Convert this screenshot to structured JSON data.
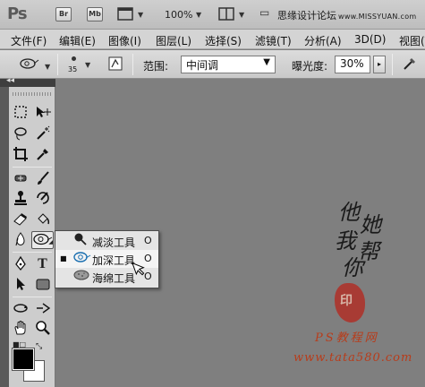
{
  "app": {
    "logo": "Ps",
    "bridge_label": "Br",
    "minibridge_label": "Mb",
    "zoom": "100%",
    "watermark_text": "思缘设计论坛",
    "watermark_url": "www.MISSYUAN.com"
  },
  "menu": [
    "文件(F)",
    "编辑(E)",
    "图像(I)",
    "图层(L)",
    "选择(S)",
    "滤镜(T)",
    "分析(A)",
    "3D(D)",
    "视图(V)"
  ],
  "options": {
    "brush_size": "35",
    "range_label": "范围:",
    "range_value": "中间调",
    "exposure_label": "曝光度:",
    "exposure_value": "30%"
  },
  "panel": {
    "collapse_glyph": "◂◂"
  },
  "flyout": [
    {
      "label": "减淡工具",
      "key": "O",
      "icon": "dodge-icon",
      "selected": false
    },
    {
      "label": "加深工具",
      "key": "O",
      "icon": "burn-icon",
      "selected": true
    },
    {
      "label": "海绵工具",
      "key": "O",
      "icon": "sponge-icon",
      "selected": false
    }
  ],
  "canvas_art": {
    "calligraphy": [
      "他",
      "她",
      "我",
      "帮",
      "你"
    ],
    "seal": "印",
    "brand": "PS教程网",
    "url": "www.tata580.com"
  },
  "colors": {
    "foreground": "#000000",
    "background": "#ffffff",
    "canvas": "#7f7f7f",
    "brand_red": "#b83c1a"
  }
}
